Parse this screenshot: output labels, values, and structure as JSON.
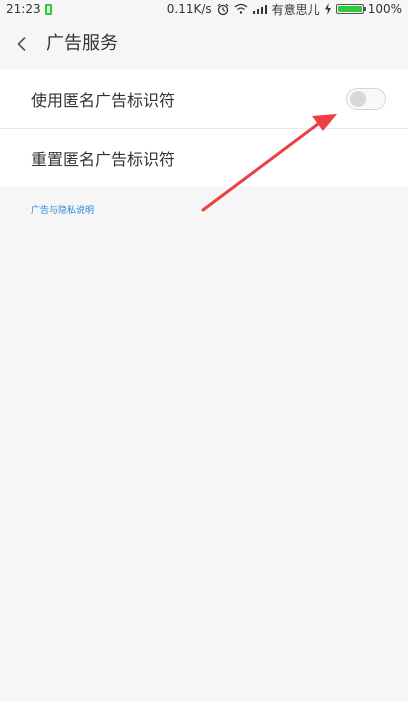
{
  "status_bar": {
    "time": "21:23",
    "network_speed": "0.11K/s",
    "carrier": "有意思儿",
    "battery": "100%",
    "icons": {
      "battery_small": "battery-small-icon",
      "alarm": "alarm-icon",
      "wifi": "wifi-icon",
      "signal": "signal-icon",
      "charging": "charging-icon",
      "battery": "battery-icon"
    }
  },
  "header": {
    "title": "广告服务",
    "back_icon": "back-icon"
  },
  "settings": {
    "items": [
      {
        "label": "使用匿名广告标识符",
        "control": "toggle",
        "enabled": false
      },
      {
        "label": "重置匿名广告标识符",
        "control": "none"
      }
    ]
  },
  "footer": {
    "privacy_link": "广告与隐私说明"
  },
  "colors": {
    "background": "#f6f6f6",
    "text": "#333333",
    "link": "#2b88d8",
    "arrow": "#ee3f45",
    "battery": "#2ecc3a"
  }
}
